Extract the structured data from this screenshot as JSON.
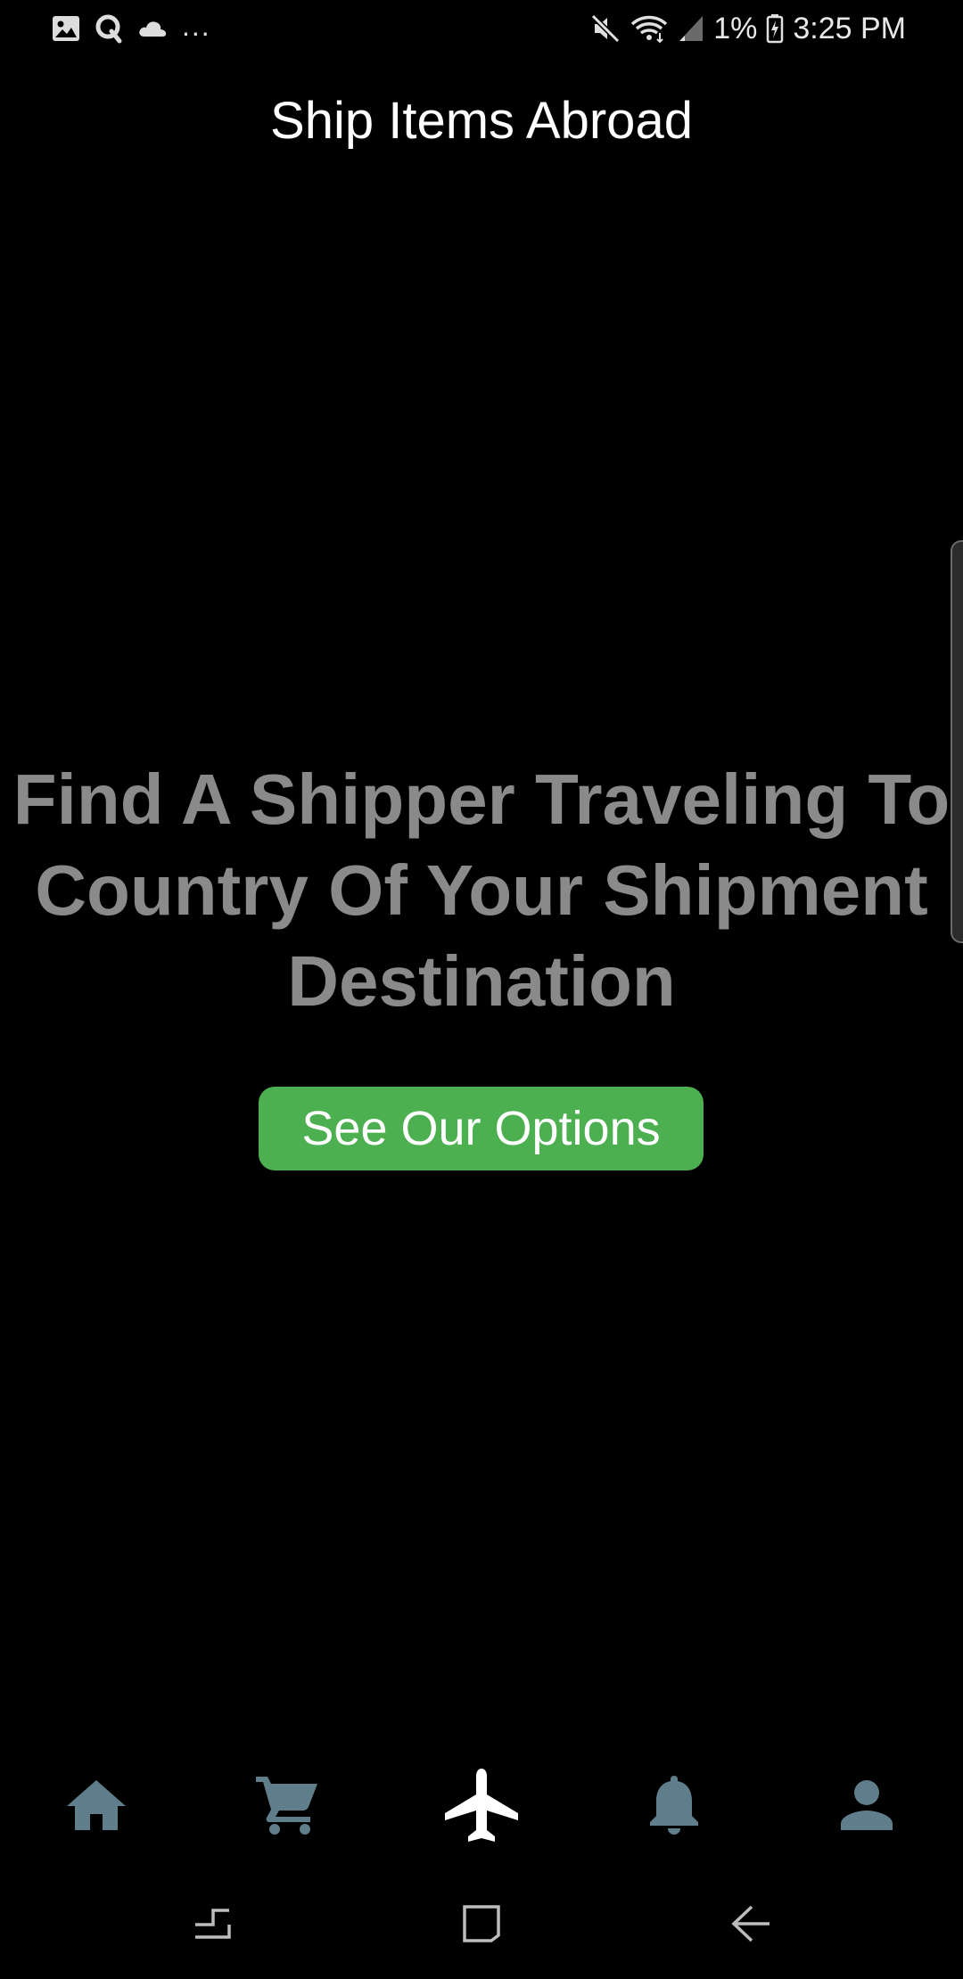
{
  "status_bar": {
    "left_icons": [
      "image-icon",
      "q-app-icon",
      "cloud-icon"
    ],
    "more_indicator": "...",
    "right_icons": [
      "mute-icon",
      "wifi-icon",
      "signal-icon"
    ],
    "battery_percent": "1%",
    "battery_icon": "battery-charging-icon",
    "time": "3:25 PM"
  },
  "header": {
    "title": "Ship Items Abroad"
  },
  "main": {
    "hero_lines": [
      "Find A Shipper Traveling To",
      "Country Of Your Shipment",
      "Destination"
    ],
    "cta_label": "See Our Options"
  },
  "bottom_nav": {
    "items": [
      {
        "icon": "home-icon",
        "active": false
      },
      {
        "icon": "cart-icon",
        "active": false
      },
      {
        "icon": "airplane-icon",
        "active": true
      },
      {
        "icon": "bell-icon",
        "active": false
      },
      {
        "icon": "person-icon",
        "active": false
      }
    ]
  },
  "system_nav": {
    "buttons": [
      "recents-button",
      "home-button",
      "back-button"
    ]
  },
  "colors": {
    "background": "#000000",
    "title": "#ffffff",
    "hero_text": "#8a8a8a",
    "cta_background": "#4caf50",
    "cta_text": "#ffffff",
    "nav_inactive": "#607d8b",
    "nav_active": "#ffffff",
    "system_nav": "#bdbdbd"
  }
}
